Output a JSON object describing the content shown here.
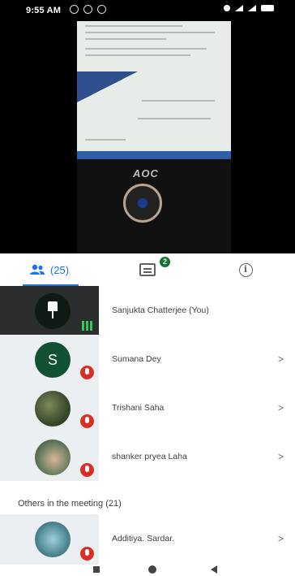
{
  "status_bar": {
    "time": "9:55 AM"
  },
  "tabs": {
    "people_count": "(25)",
    "chat_badge": "2"
  },
  "participants": [
    {
      "name": "Sanjukta Chatterjee (You)"
    },
    {
      "name": "Sumana Dey",
      "initial": "S"
    },
    {
      "name": "Trishani Saha"
    },
    {
      "name": "shanker pryea Laha"
    }
  ],
  "others_section": {
    "title": "Others in the meeting (21)"
  },
  "others": [
    {
      "name": "Additiya. Sardar."
    }
  ],
  "video": {
    "monitor_brand": "AOC"
  },
  "chevron": ">",
  "colors": {
    "accent": "#1a73e8",
    "muted_red": "#d93025",
    "speaking_green": "#34c759"
  }
}
